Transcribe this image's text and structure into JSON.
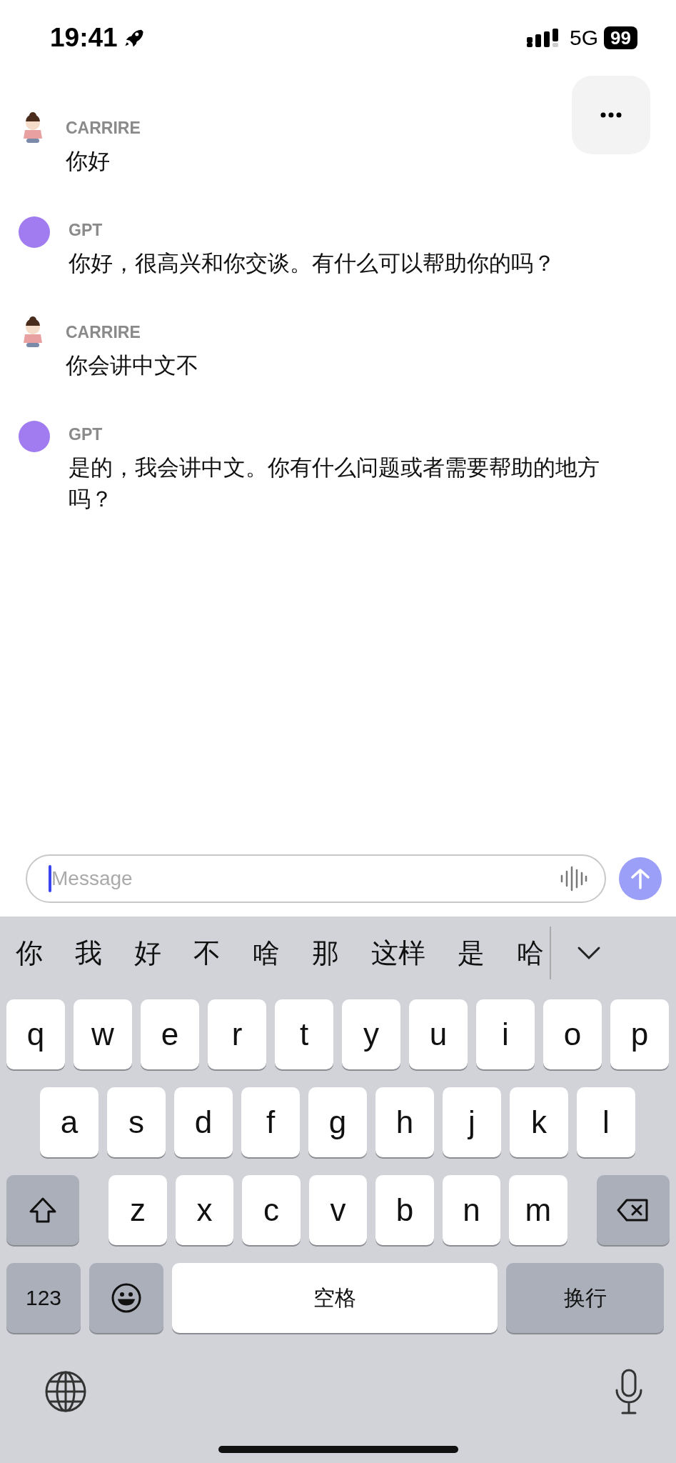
{
  "status_bar": {
    "time": "19:41",
    "network": "5G",
    "battery": "99"
  },
  "messages": [
    {
      "sender": "CARRIRE",
      "kind": "user",
      "text": "你好"
    },
    {
      "sender": "GPT",
      "kind": "bot",
      "text": "你好，很高兴和你交谈。有什么可以帮助你的吗？"
    },
    {
      "sender": "CARRIRE",
      "kind": "user",
      "text": "你会讲中文不"
    },
    {
      "sender": "GPT",
      "kind": "bot",
      "text": "是的，我会讲中文。你有什么问题或者需要帮助的地方吗？"
    }
  ],
  "composer": {
    "placeholder": "Message"
  },
  "keyboard": {
    "candidates": [
      "你",
      "我",
      "好",
      "不",
      "啥",
      "那",
      "这样",
      "是",
      "哈"
    ],
    "rows": [
      {
        "keys": [
          {
            "kind": "letter",
            "label": "q"
          },
          {
            "kind": "letter",
            "label": "w"
          },
          {
            "kind": "letter",
            "label": "e"
          },
          {
            "kind": "letter",
            "label": "r"
          },
          {
            "kind": "letter",
            "label": "t"
          },
          {
            "kind": "letter",
            "label": "y"
          },
          {
            "kind": "letter",
            "label": "u"
          },
          {
            "kind": "letter",
            "label": "i"
          },
          {
            "kind": "letter",
            "label": "o"
          },
          {
            "kind": "letter",
            "label": "p"
          }
        ]
      },
      {
        "keys": [
          {
            "kind": "letter",
            "label": "a"
          },
          {
            "kind": "letter",
            "label": "s"
          },
          {
            "kind": "letter",
            "label": "d"
          },
          {
            "kind": "letter",
            "label": "f"
          },
          {
            "kind": "letter",
            "label": "g"
          },
          {
            "kind": "letter",
            "label": "h"
          },
          {
            "kind": "letter",
            "label": "j"
          },
          {
            "kind": "letter",
            "label": "k"
          },
          {
            "kind": "letter",
            "label": "l"
          }
        ]
      },
      {
        "keys": [
          {
            "kind": "shift"
          },
          {
            "kind": "letter",
            "label": "z"
          },
          {
            "kind": "letter",
            "label": "x"
          },
          {
            "kind": "letter",
            "label": "c"
          },
          {
            "kind": "letter",
            "label": "v"
          },
          {
            "kind": "letter",
            "label": "b"
          },
          {
            "kind": "letter",
            "label": "n"
          },
          {
            "kind": "letter",
            "label": "m"
          },
          {
            "kind": "delete"
          }
        ]
      },
      {
        "keys": [
          {
            "kind": "mode",
            "label": "123"
          },
          {
            "kind": "emoji"
          },
          {
            "kind": "space",
            "label": "空格"
          },
          {
            "kind": "return",
            "label": "换行"
          }
        ]
      }
    ]
  }
}
